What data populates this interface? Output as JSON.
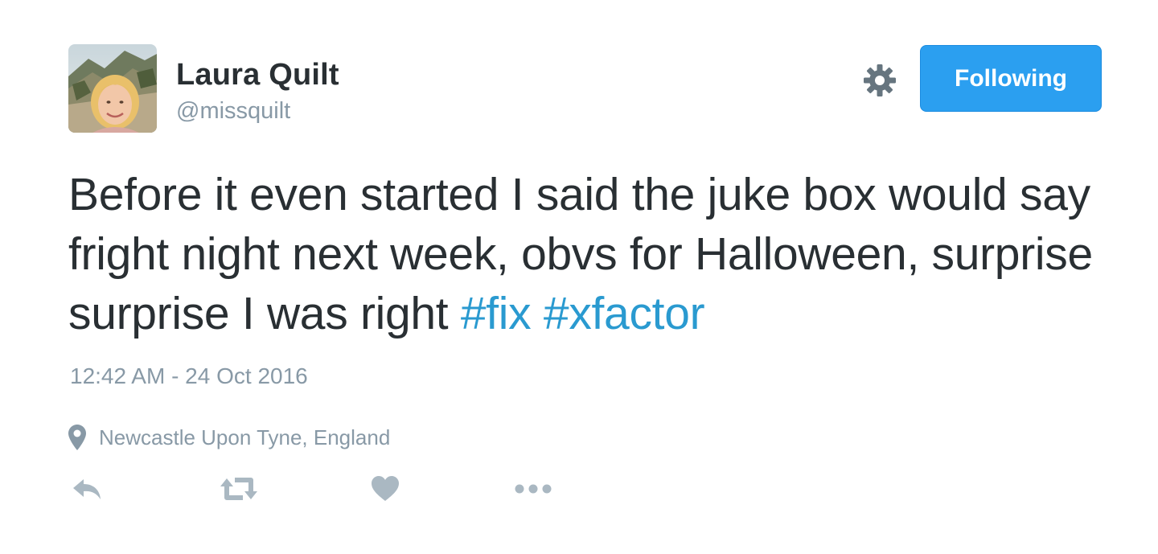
{
  "user": {
    "name": "Laura Quilt",
    "handle": "@missquilt"
  },
  "header": {
    "follow_label": "Following",
    "settings_icon": "gear-icon"
  },
  "tweet": {
    "text_plain": "Before it even started I said the juke box would say fright night next week, obvs for Halloween, surprise surprise I was right ",
    "hashtags": [
      "#fix",
      "#xfactor"
    ],
    "timestamp": "12:42 AM - 24 Oct 2016",
    "location": "Newcastle Upon Tyne, England"
  },
  "actions": {
    "icons": [
      "reply-icon",
      "retweet-icon",
      "like-icon",
      "more-icon"
    ]
  },
  "colors": {
    "follow_button": "#2b9ff0",
    "hashtag": "#2a9ad0",
    "muted_text": "#8899a6",
    "main_text": "#292f33"
  }
}
